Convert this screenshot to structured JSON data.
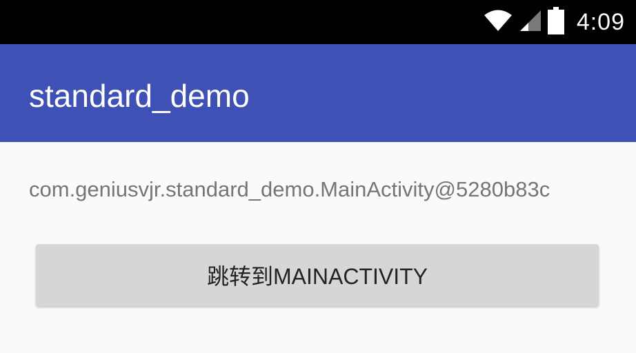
{
  "status_bar": {
    "time": "4:09",
    "icons": [
      "wifi-icon",
      "cell-signal-icon",
      "battery-icon"
    ],
    "background": "#000000"
  },
  "app_bar": {
    "title": "standard_demo",
    "background": "#3f51b5"
  },
  "main": {
    "activity_text": "com.geniusvjr.standard_demo.MainActivity@5280b83c",
    "button_label": "跳转到MAINACTIVITY"
  }
}
